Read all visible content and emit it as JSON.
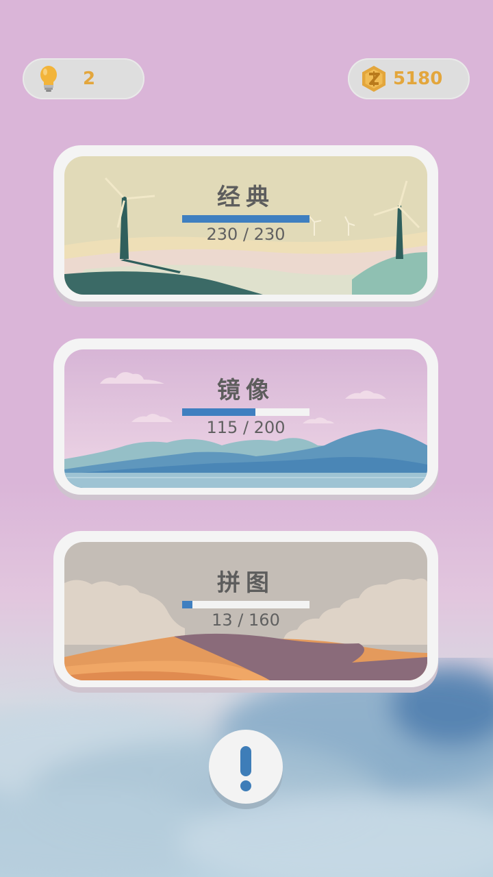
{
  "hints": {
    "count": "2",
    "icon": "lightbulb-icon"
  },
  "coins": {
    "count": "5180",
    "icon": "coin-icon"
  },
  "modes": [
    {
      "title": "经典",
      "progress_text": "230 / 230",
      "progress": 1.0,
      "theme": "windmill-hills"
    },
    {
      "title": "镜像",
      "progress_text": "115 / 200",
      "progress": 0.575,
      "theme": "mountain-lake"
    },
    {
      "title": "拼图",
      "progress_text": "13 / 160",
      "progress": 0.08125,
      "theme": "desert-dunes"
    }
  ],
  "info_button": {
    "icon": "exclamation-icon"
  },
  "colors": {
    "accent_blue": "#3f7fc0",
    "gold": "#e3a63c",
    "background": "#dab5d8"
  }
}
